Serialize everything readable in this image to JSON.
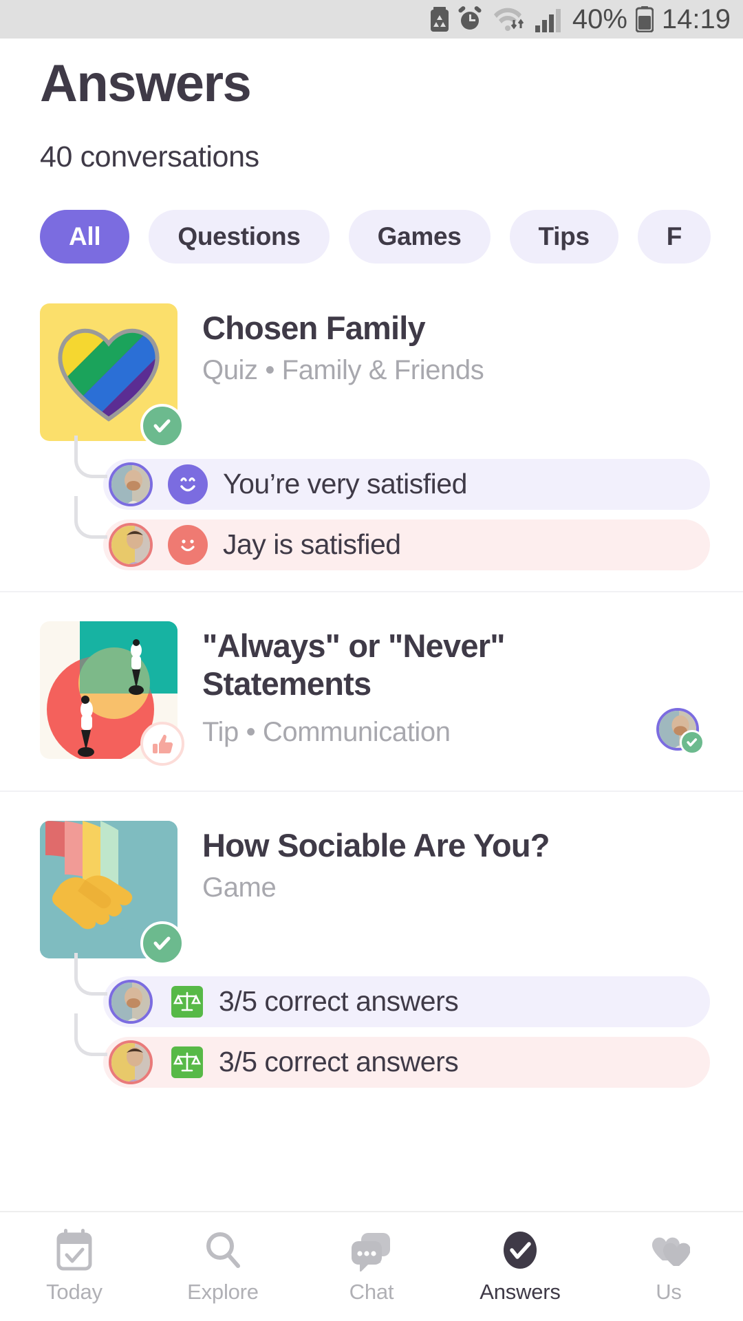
{
  "statusbar": {
    "battery_percent": "40%",
    "time": "14:19",
    "icons": [
      "battery-saver-icon",
      "alarm-icon",
      "wifi-icon",
      "signal-icon",
      "battery-icon"
    ]
  },
  "header": {
    "title": "Answers",
    "subtitle": "40 conversations"
  },
  "filters": [
    {
      "label": "All",
      "active": true
    },
    {
      "label": "Questions",
      "active": false
    },
    {
      "label": "Games",
      "active": false
    },
    {
      "label": "Tips",
      "active": false
    },
    {
      "label": "F",
      "active": false
    }
  ],
  "conversations": [
    {
      "title": "Chosen Family",
      "subtitle": "Quiz • Family & Friends",
      "thumb_emoji": "❤️",
      "thumb_style": "rainbow-heart",
      "badge": "check",
      "answers": [
        {
          "who": "you",
          "mood": "purple",
          "text": "You’re very satisfied"
        },
        {
          "who": "partner",
          "mood": "salmon",
          "text": "Jay is satisfied"
        }
      ]
    },
    {
      "title": "\"Always\" or \"Never\" Statements",
      "subtitle": "Tip • Communication",
      "thumb_emoji": "",
      "thumb_style": "shapes-illustration",
      "badge": "thumbup",
      "answers": [],
      "right_avatar": {
        "ring": "purple",
        "badge": "check"
      }
    },
    {
      "title": "How Sociable Are You?",
      "subtitle": "Game",
      "thumb_emoji": "🤝",
      "thumb_style": "rainbow-arcs",
      "badge": "check",
      "answers": [
        {
          "who": "you",
          "mood": "scales",
          "text": "3/5 correct answers"
        },
        {
          "who": "partner",
          "mood": "scales",
          "text": "3/5 correct answers"
        }
      ]
    }
  ],
  "bottomnav": [
    {
      "label": "Today",
      "icon": "calendar-check-icon",
      "active": false
    },
    {
      "label": "Explore",
      "icon": "search-icon",
      "active": false
    },
    {
      "label": "Chat",
      "icon": "chat-bubbles-icon",
      "active": false
    },
    {
      "label": "Answers",
      "icon": "check-circle-icon",
      "active": true
    },
    {
      "label": "Us",
      "icon": "hearts-icon",
      "active": false
    }
  ],
  "colors": {
    "accent": "#7b6ce0",
    "you_row_bg": "#f2f0fc",
    "partner_row_bg": "#fdeeee",
    "text_dark": "#3f3a47",
    "text_muted": "#a8a8ae",
    "badge_green": "#6cba8e",
    "salmon": "#ef7a72"
  }
}
